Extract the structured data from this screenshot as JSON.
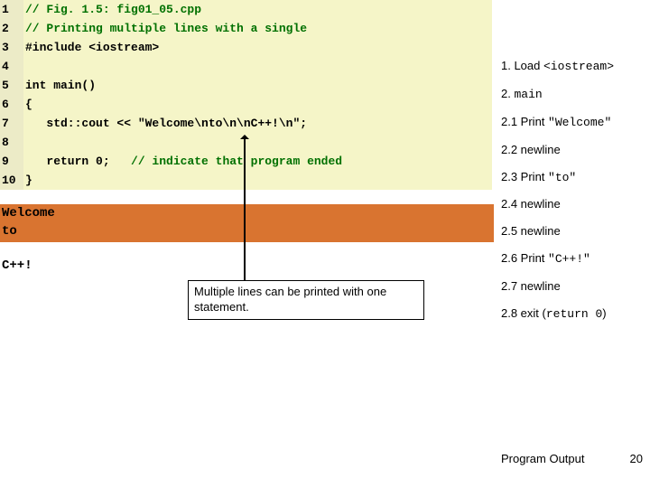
{
  "code": {
    "lines": [
      {
        "n": "1",
        "t": "// Fig. 1.5: fig01_05.cpp",
        "c": true
      },
      {
        "n": "2",
        "t": "// Printing multiple lines with a single",
        "c": true
      },
      {
        "n": "3",
        "t": "#include <iostream>",
        "c": false
      },
      {
        "n": "4",
        "t": "",
        "c": false
      },
      {
        "n": "5",
        "t": "int main()",
        "c": false
      },
      {
        "n": "6",
        "t": "{",
        "c": false
      },
      {
        "n": "7",
        "t": "   std::cout << \"Welcome\\nto\\n\\nC++!\\n\";",
        "c": false
      },
      {
        "n": "8",
        "t": "",
        "c": false
      },
      {
        "n": "9",
        "t": "   return 0;   ",
        "tc": "// indicate that program ended",
        "c": false
      },
      {
        "n": "10",
        "t": "}",
        "c": false
      }
    ]
  },
  "output": {
    "welcome_to": "Welcome\nto ",
    "cpp": "C++!"
  },
  "annotations": {
    "a1": {
      "p": "1. Load ",
      "m": "<iostream>"
    },
    "a2": {
      "p": "2. ",
      "m": "main"
    },
    "a3": {
      "p": "2.1 Print ",
      "m": "\"Welcome\""
    },
    "a4": "2.2 newline",
    "a5": {
      "p": "2.3 Print ",
      "m": "\"to\""
    },
    "a6": "2.4 newline",
    "a7": "2.5 newline",
    "a8": {
      "p": "2.6 Print ",
      "m": "\"C++!\""
    },
    "a9": "2.7 newline",
    "a10": {
      "p": "2.8 exit (",
      "m": "return 0",
      "s": ")"
    }
  },
  "callout": "Multiple lines can be printed with one statement.",
  "program_output_label": "Program Output",
  "pagenum": "20"
}
